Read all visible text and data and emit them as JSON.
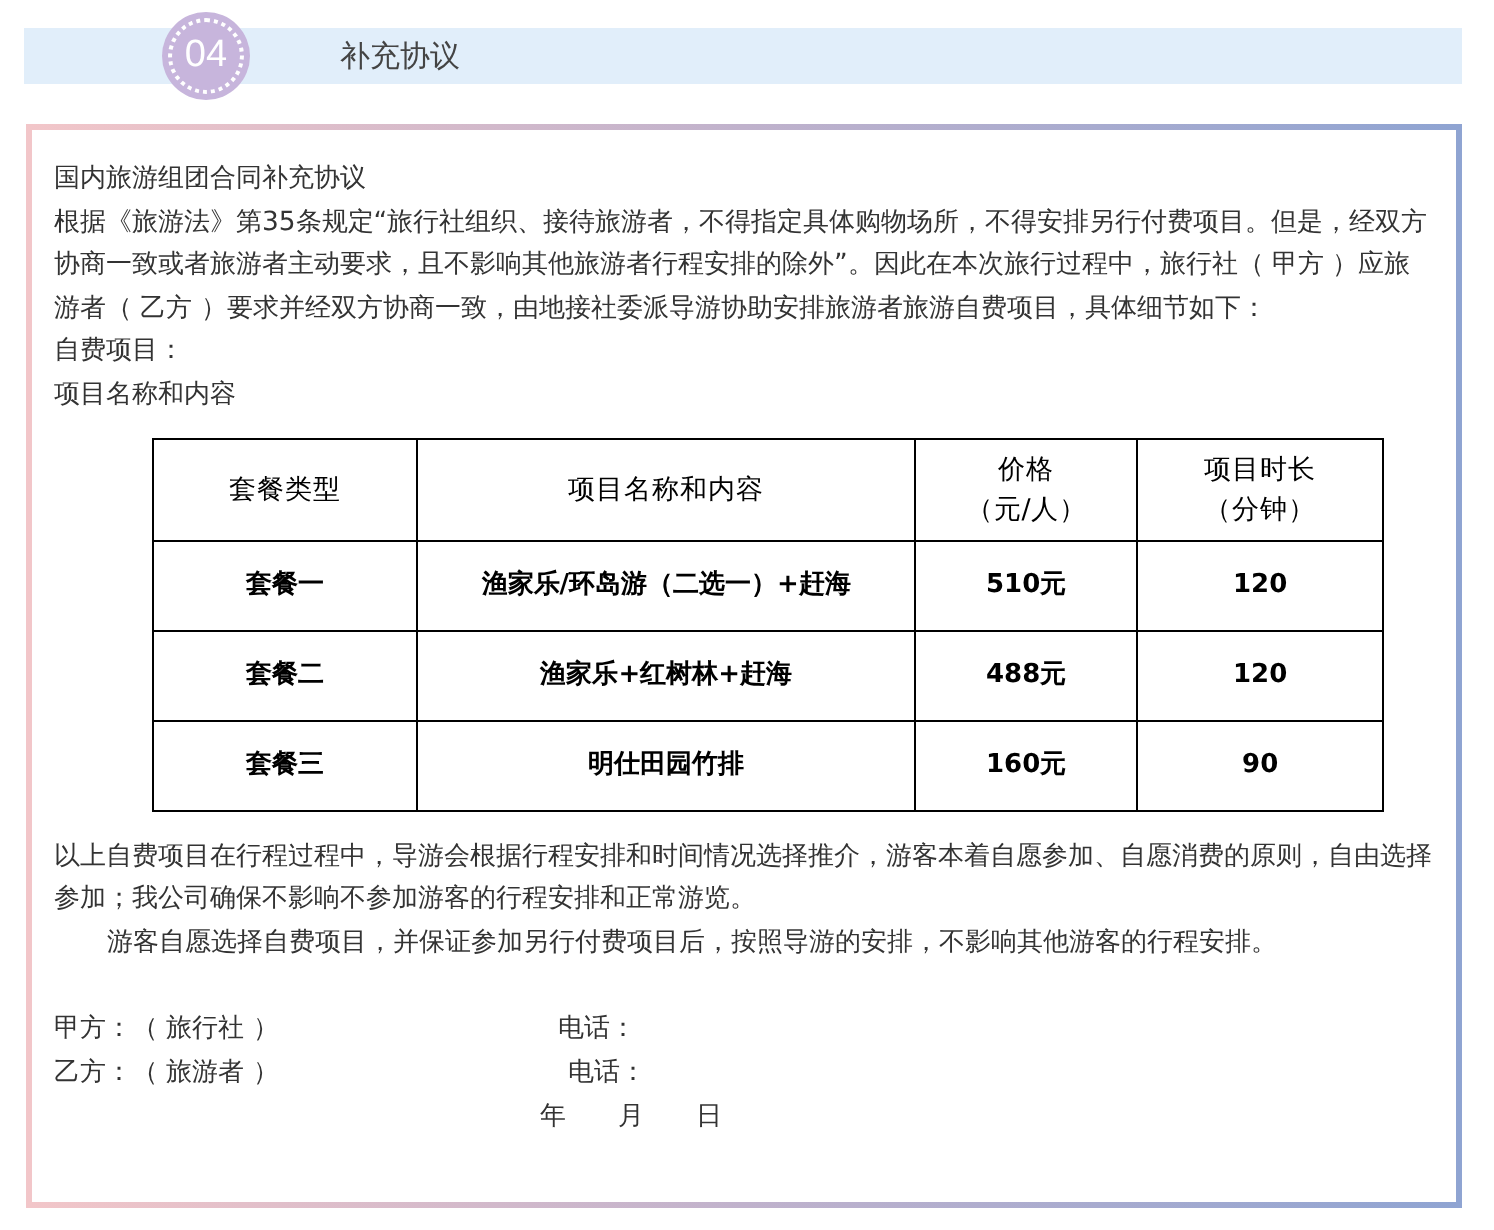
{
  "section": {
    "number": "04",
    "title": "补充协议"
  },
  "agreement": {
    "heading": "国内旅游组团合同补充协议",
    "intro": "根据《旅游法》第35条规定“旅行社组织、接待旅游者，不得指定具体购物场所，不得安排另行付费项目。但是，经双方协商一致或者旅游者主动要求，且不影响其他旅游者行程安排的除外”。因此在本次旅行过程中，旅行社（ 甲方 ）应旅游者（ 乙方 ）要求并经双方协商一致，由地接社委派导游协助安排旅游者旅游自费项目，具体细节如下：",
    "label_1": "自费项目：",
    "label_2": "项目名称和内容",
    "table": {
      "columns": [
        {
          "label": "套餐类型"
        },
        {
          "label": "项目名称和内容"
        },
        {
          "label": "价格",
          "unit": "（元/人）"
        },
        {
          "label": "项目时长",
          "unit": "（分钟）"
        }
      ],
      "rows": [
        [
          "套餐一",
          "渔家乐/环岛游（二选一）+赶海",
          "510元",
          "120"
        ],
        [
          "套餐二",
          "渔家乐+红树林+赶海",
          "488元",
          "120"
        ],
        [
          "套餐三",
          "明仕田园竹排",
          "160元",
          "90"
        ]
      ]
    },
    "note": "以上自费项目在行程过程中，导游会根据行程安排和时间情况选择推介，游客本着自愿参加、自愿消费的原则，自由选择参加；我公司确保不影响不参加游客的行程安排和正常游览。",
    "note_2": "游客自愿选择自费项目，并保证参加另行付费项目后，按照导游的安排，不影响其他游客的行程安排。",
    "signatures": [
      {
        "party": "甲方：（ 旅行社 ）",
        "phone": "电话："
      },
      {
        "party": "乙方：（ 旅游者 ）",
        "phone": "电话："
      }
    ],
    "date": [
      "年",
      "月",
      "日"
    ]
  }
}
